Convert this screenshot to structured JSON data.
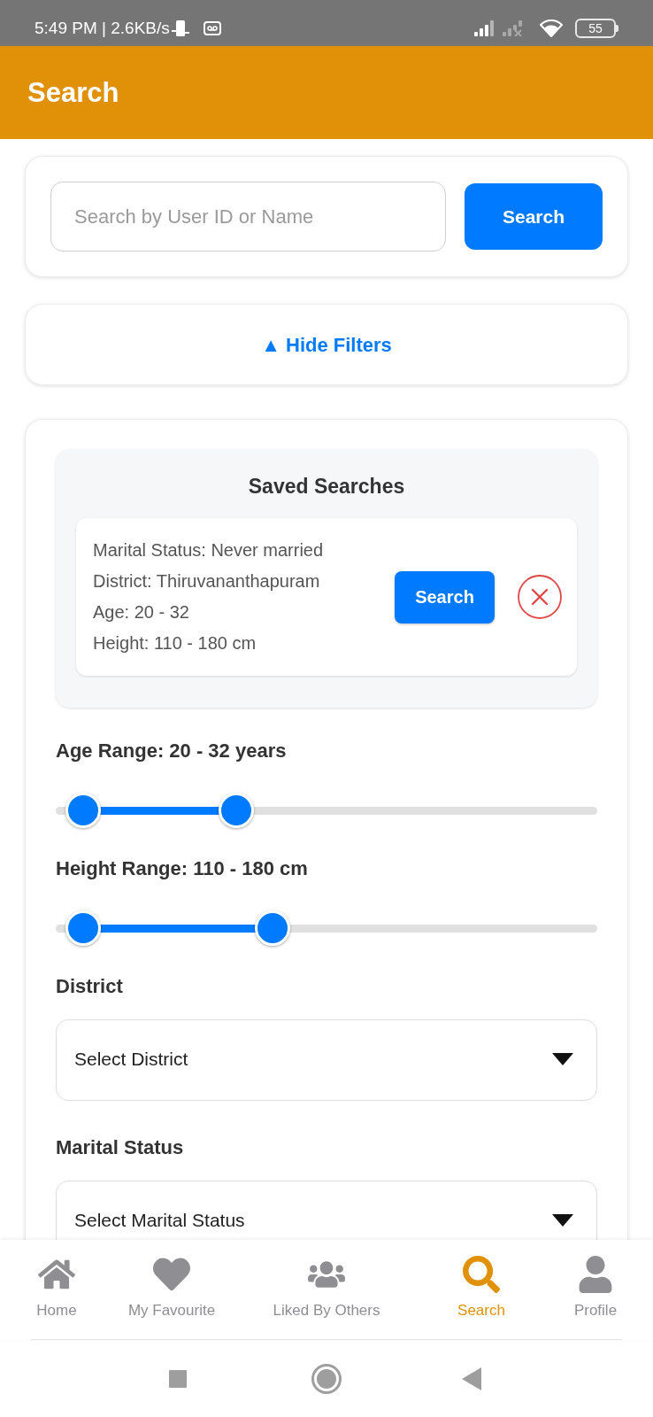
{
  "status_bar": {
    "text": "5:49 PM | 2.6KB/s",
    "battery": "55"
  },
  "header": {
    "title": "Search"
  },
  "search": {
    "placeholder": "Search by User ID or Name",
    "button": "Search"
  },
  "filter_toggle": {
    "label": "▲ Hide Filters"
  },
  "saved_searches": {
    "title": "Saved Searches",
    "items": [
      {
        "criteria": [
          "Marital Status: Never married",
          "District: Thiruvananthapuram",
          "Age: 20 - 32",
          "Height: 110 - 180 cm"
        ],
        "button": "Search"
      }
    ]
  },
  "ranges": [
    {
      "label": "Age Range: 20 - 32 years",
      "thumbs": [
        {
          "level": 0.05
        },
        {
          "level": 0.334
        }
      ]
    },
    {
      "label": "Height Range: 110 - 180 cm",
      "thumbs": [
        {
          "level": 0.05
        },
        {
          "level": 0.4
        }
      ]
    }
  ],
  "dropdowns": [
    {
      "label": "District",
      "value": "Select District"
    },
    {
      "label": "Marital Status",
      "value": "Select Marital Status"
    }
  ],
  "bottom_nav": [
    {
      "kind": "home",
      "label": "Home",
      "selected": false
    },
    {
      "kind": "heart",
      "label": "My Favourite",
      "selected": false
    },
    {
      "kind": "users",
      "label": "Liked By Others",
      "selected": false
    },
    {
      "kind": "search",
      "label": "Search",
      "selected": true
    },
    {
      "kind": "user",
      "label": "Profile",
      "selected": false
    }
  ]
}
